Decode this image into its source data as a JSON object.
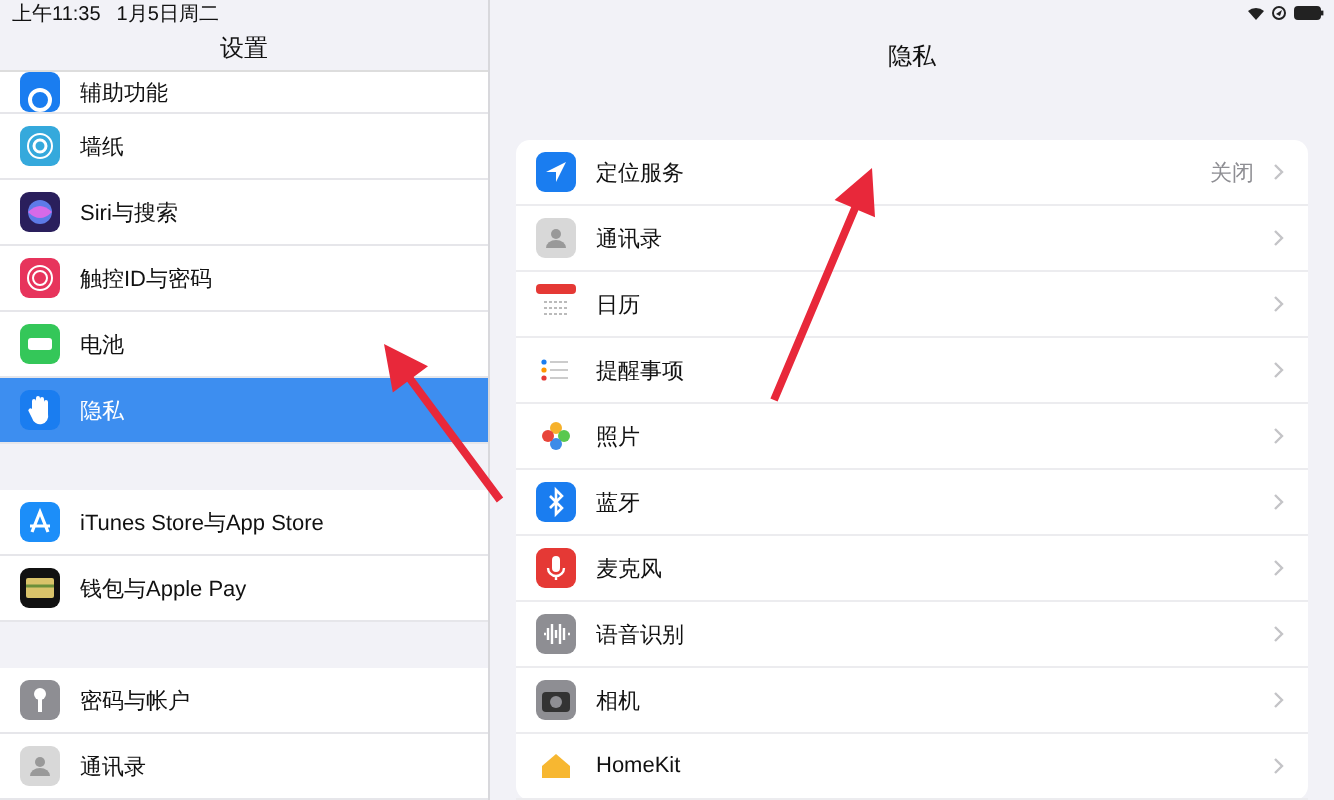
{
  "status_bar": {
    "time": "上午11:35",
    "date": "1月5日周二"
  },
  "sidebar": {
    "title": "设置",
    "groups": [
      [
        {
          "label": "辅助功能",
          "selected": false
        },
        {
          "label": "墙纸",
          "selected": false
        },
        {
          "label": "Siri与搜索",
          "selected": false
        },
        {
          "label": "触控ID与密码",
          "selected": false
        },
        {
          "label": "电池",
          "selected": false
        },
        {
          "label": "隐私",
          "selected": true
        }
      ],
      [
        {
          "label": "iTunes Store与App Store",
          "selected": false
        },
        {
          "label": "钱包与Apple Pay",
          "selected": false
        }
      ],
      [
        {
          "label": "密码与帐户",
          "selected": false
        },
        {
          "label": "通讯录",
          "selected": false
        }
      ]
    ]
  },
  "detail": {
    "title": "隐私",
    "items": [
      {
        "label": "定位服务",
        "value": "关闭"
      },
      {
        "label": "通讯录"
      },
      {
        "label": "日历"
      },
      {
        "label": "提醒事项"
      },
      {
        "label": "照片"
      },
      {
        "label": "蓝牙"
      },
      {
        "label": "麦克风"
      },
      {
        "label": "语音识别"
      },
      {
        "label": "相机"
      },
      {
        "label": "HomeKit"
      }
    ]
  }
}
